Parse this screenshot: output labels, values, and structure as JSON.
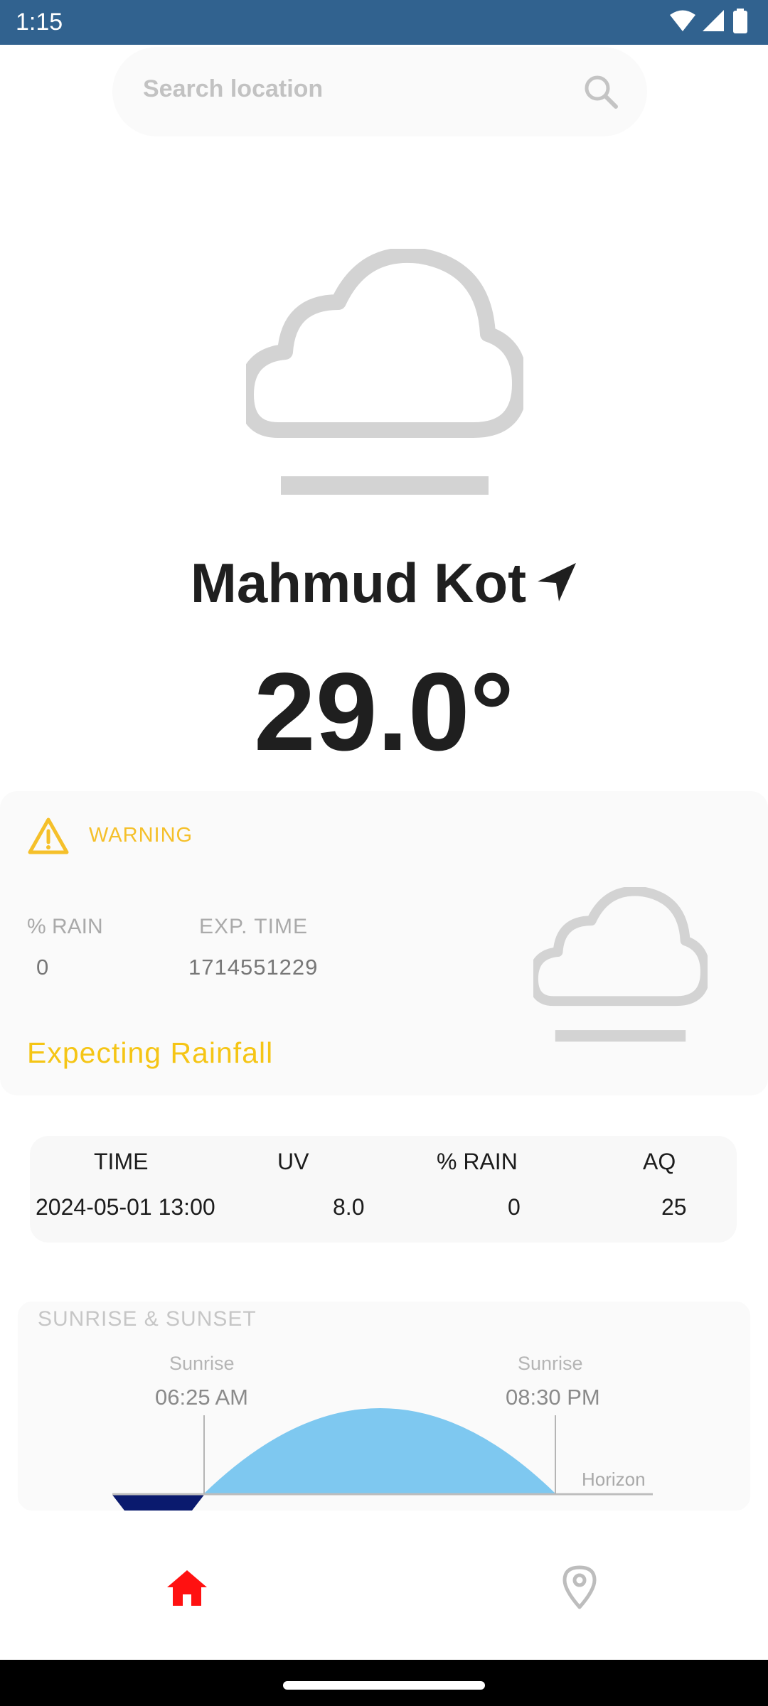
{
  "status_bar": {
    "time": "1:15"
  },
  "search": {
    "placeholder": "Search location"
  },
  "location": {
    "city": "Mahmud Kot"
  },
  "weather": {
    "temperature": "29.0°"
  },
  "warning": {
    "title": "WARNING",
    "rain_label": "% RAIN",
    "rain_value": "0",
    "exp_time_label": "EXP. TIME",
    "exp_time_value": "1714551229",
    "message": "Expecting Rainfall"
  },
  "forecast": {
    "headers": [
      "TIME",
      "UV",
      "% RAIN",
      "AQ"
    ],
    "row": [
      "2024-05-01 13:00",
      "8.0",
      "0",
      "25"
    ]
  },
  "sun": {
    "title": "SUNRISE & SUNSET",
    "sunrise_label": "Sunrise",
    "sunrise_time": "06:25 AM",
    "sunset_label": "Sunrise",
    "sunset_time": "08:30 PM",
    "horizon_label": "Horizon"
  },
  "nav": {
    "items": [
      "home-icon",
      "location-pin-icon"
    ],
    "active_color": "#ff1111"
  },
  "colors": {
    "status_bar": "#31628f",
    "warning": "#f5c02a",
    "day_arc": "#7ec8f0",
    "night_arc": "#0a1a6e"
  }
}
